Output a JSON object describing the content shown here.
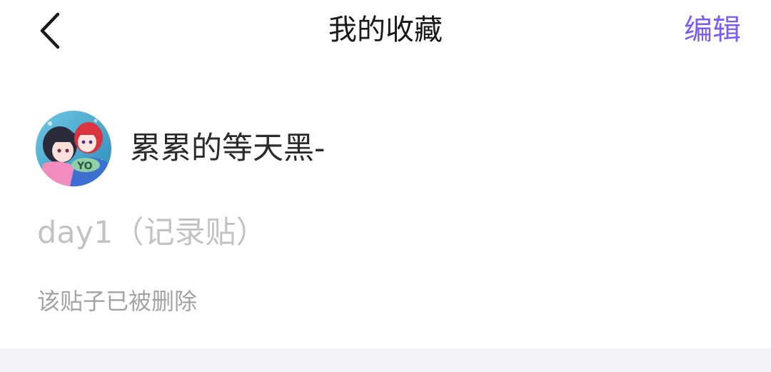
{
  "header": {
    "title": "我的收藏",
    "edit_label": "编辑",
    "back_icon": "chevron-left-icon"
  },
  "favorite": {
    "author_name": "累累的等天黑-",
    "post_title": "day1（记录贴）",
    "status_note": "该贴子已被删除"
  },
  "colors": {
    "accent": "#7a5cf0",
    "title_text": "#1a1a1a",
    "muted_title": "#c3c3c3",
    "note_text": "#a3a3a3",
    "band": "#f5f5f7"
  }
}
